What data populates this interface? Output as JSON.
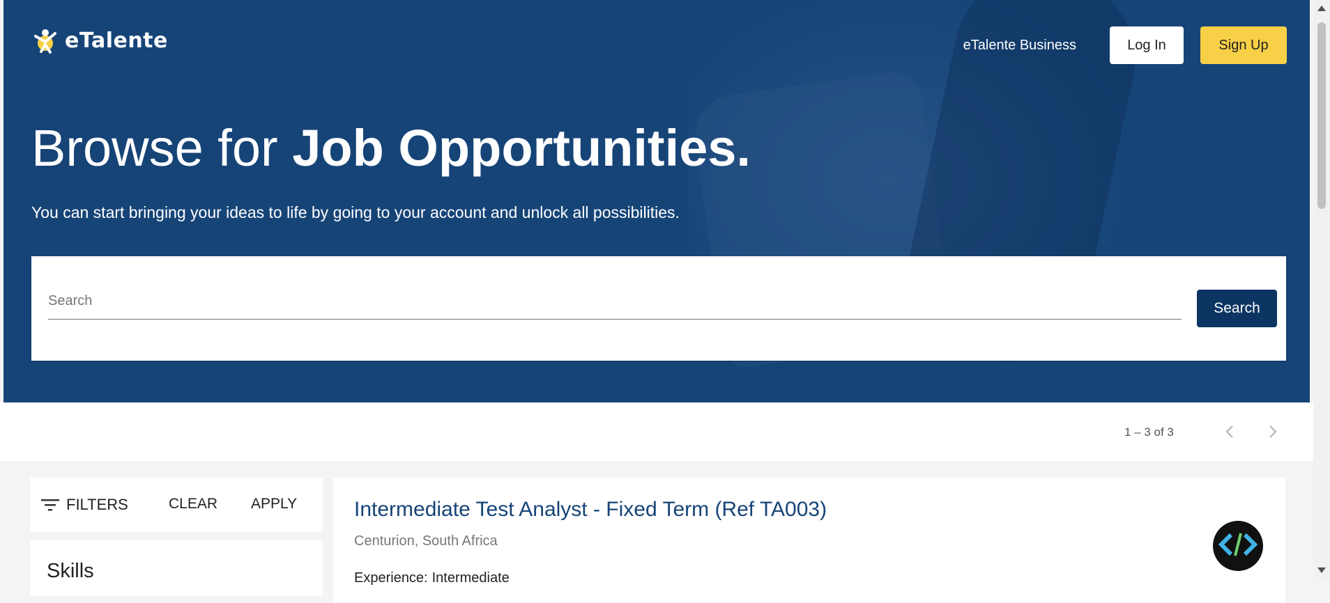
{
  "header": {
    "logo_text": "eTalente",
    "business_link": "eTalente Business",
    "login_label": "Log In",
    "signup_label": "Sign Up"
  },
  "hero": {
    "title_regular": "Browse for ",
    "title_bold": "Job Opportunities.",
    "subtitle": "You can start bringing your ideas to life by going to your account and unlock all possibilities."
  },
  "search": {
    "placeholder": "Search",
    "button_label": "Search"
  },
  "paginator": {
    "range_label": "1 – 3 of 3"
  },
  "filters": {
    "label": "FILTERS",
    "clear_label": "CLEAR",
    "apply_label": "APPLY",
    "skills_title": "Skills"
  },
  "jobs": [
    {
      "title": "Intermediate Test Analyst - Fixed Term (Ref TA003)",
      "location": "Centurion, South Africa",
      "experience_label": "Experience:",
      "experience_value": "Intermediate",
      "company_logo_icon": "enviro365-logo-icon"
    }
  ],
  "colors": {
    "hero_bg": "#164477",
    "accent_yellow": "#f8d047",
    "primary_dark": "#0d3563"
  }
}
